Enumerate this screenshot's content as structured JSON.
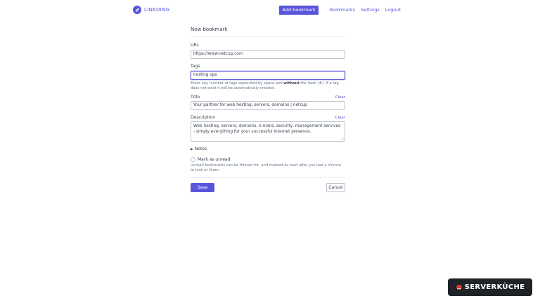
{
  "header": {
    "brand": "LINKDING",
    "nav": {
      "add_bookmark": "Add bookmark",
      "bookmarks": "Bookmarks",
      "settings": "Settings",
      "logout": "Logout"
    }
  },
  "form": {
    "title": "New bookmark",
    "url": {
      "label": "URL",
      "value": "https://www.netcup.com"
    },
    "tags": {
      "label": "Tags",
      "value": "hosting vps",
      "help_before": "Enter any number of tags separated by space and ",
      "help_bold": "without",
      "help_after": " the hash (#). If a tag does not exist it will be automatically created."
    },
    "title_field": {
      "label": "Title",
      "clear": "Clear",
      "value": "Your partner for web hosting, servers, domains | netcup"
    },
    "description": {
      "label": "Description",
      "clear": "Clear",
      "value": "Web hosting, servers, domains, e-mails, security, management services - simply everything for your successful internet presence."
    },
    "notes": {
      "toggle": "Notes"
    },
    "unread": {
      "label": "Mark as unread",
      "checked": false,
      "help": "Unread bookmarks can be filtered for, and marked as read after you had a chance to look at them."
    },
    "save": "Save",
    "cancel": "Cancel"
  },
  "badge": {
    "text": "SERVERKÜCHE"
  },
  "colors": {
    "accent": "#5755d9",
    "border": "#bcc3ce",
    "badge_bg": "#1f2226"
  }
}
